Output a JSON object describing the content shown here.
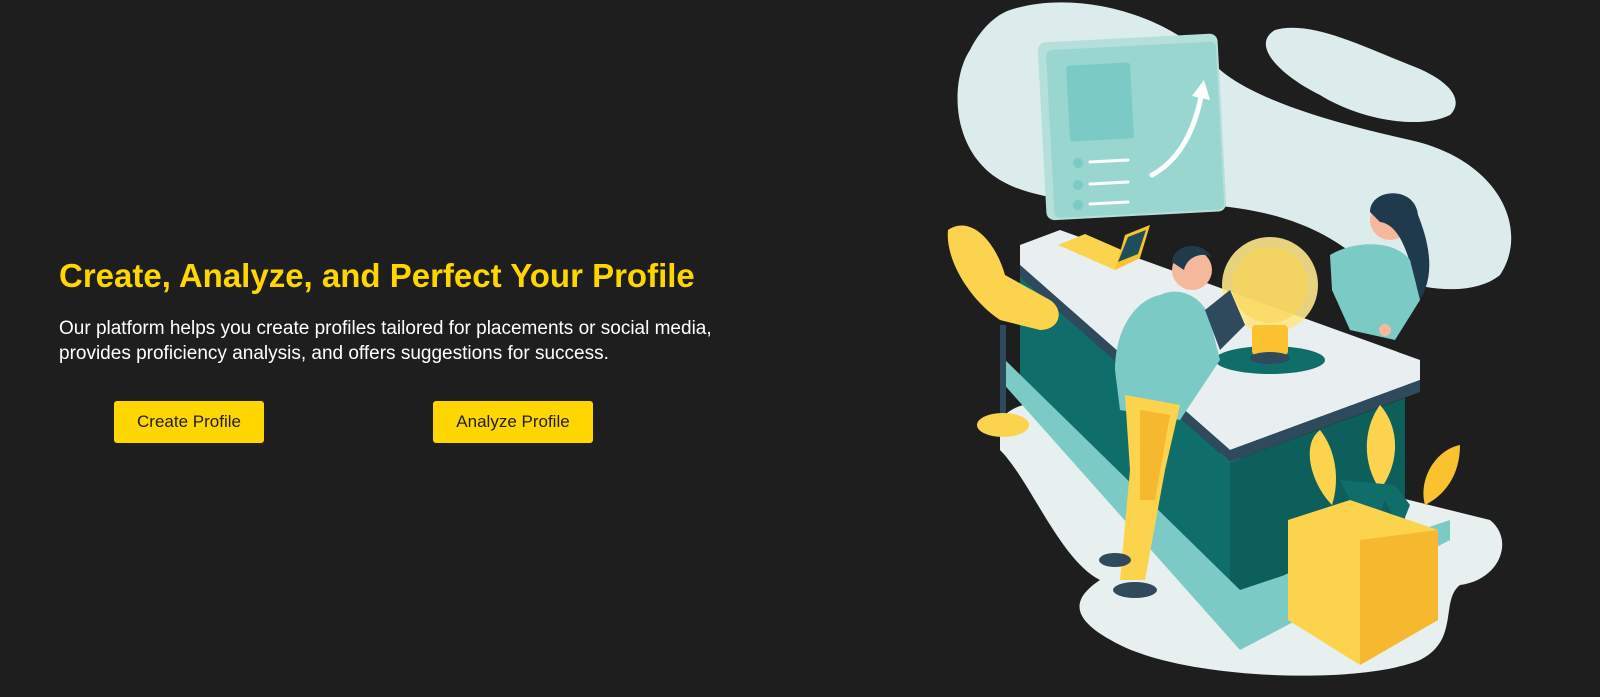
{
  "hero": {
    "title": "Create, Analyze, and Perfect Your Profile",
    "description": "Our platform helps you create profiles tailored for placements or social media, provides proficiency analysis, and offers suggestions for success."
  },
  "buttons": {
    "create_label": "Create Profile",
    "analyze_label": "Analyze Profile"
  },
  "colors": {
    "background": "#1e1e1e",
    "accent": "#FFD600",
    "text": "#ffffff"
  }
}
